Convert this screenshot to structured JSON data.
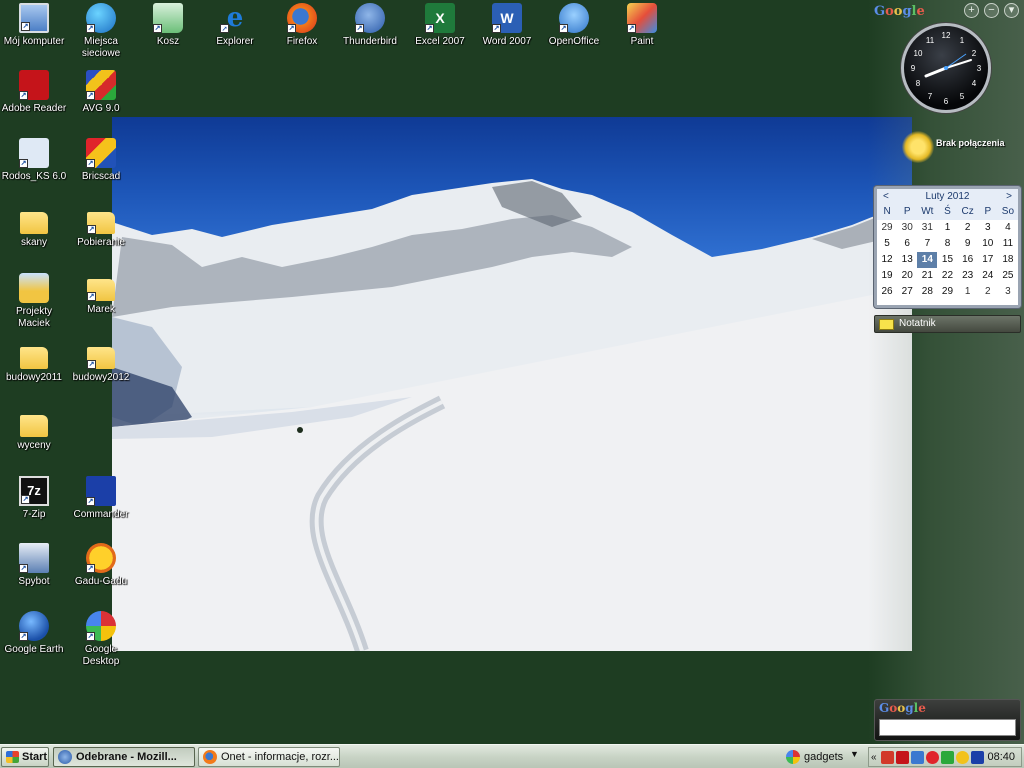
{
  "desktop_icons": [
    {
      "label": "Mój komputer",
      "icon": "computer-icon"
    },
    {
      "label": "Miejsca sieciowe",
      "icon": "network-places-icon"
    },
    {
      "label": "Kosz",
      "icon": "recycle-bin-icon"
    },
    {
      "label": "Explorer",
      "icon": "internet-explorer-icon"
    },
    {
      "label": "Firefox",
      "icon": "firefox-icon"
    },
    {
      "label": "Thunderbird",
      "icon": "thunderbird-icon"
    },
    {
      "label": "Excel 2007",
      "icon": "excel-icon",
      "glyph": "X"
    },
    {
      "label": "Word 2007",
      "icon": "word-icon",
      "glyph": "W"
    },
    {
      "label": "OpenOffice",
      "icon": "openoffice-icon"
    },
    {
      "label": "Paint",
      "icon": "paint-icon"
    },
    {
      "label": "Adobe Reader",
      "icon": "adobe-reader-icon"
    },
    {
      "label": "AVG 9.0",
      "icon": "avg-icon"
    },
    {
      "label": "Rodos_KS 6.0",
      "icon": "rodos-icon"
    },
    {
      "label": "Bricscad",
      "icon": "bricscad-icon"
    },
    {
      "label": "skany",
      "icon": "folder-icon"
    },
    {
      "label": "Pobieranie",
      "icon": "folder-icon"
    },
    {
      "label": "Projekty Maciek",
      "icon": "projects-icon"
    },
    {
      "label": "Marek",
      "icon": "folder-icon"
    },
    {
      "label": "budowy2011",
      "icon": "folder-icon"
    },
    {
      "label": "budowy2012",
      "icon": "folder-icon"
    },
    {
      "label": "wyceny",
      "icon": "folder-icon"
    },
    {
      "label": "7-Zip",
      "icon": "7zip-icon",
      "glyph": "7z"
    },
    {
      "label": "Commander",
      "icon": "commander-icon"
    },
    {
      "label": "Spybot",
      "icon": "spybot-icon"
    },
    {
      "label": "Gadu-Gadu",
      "icon": "gadu-gadu-icon"
    },
    {
      "label": "Google Earth",
      "icon": "google-earth-icon"
    },
    {
      "label": "Google Desktop",
      "icon": "google-desktop-icon"
    }
  ],
  "sidebar": {
    "logo": {
      "g1": "G",
      "o1": "o",
      "o2": "o",
      "g2": "g",
      "l": "l",
      "e": "e"
    },
    "buttons": [
      "+",
      "−",
      "▾"
    ],
    "clock": {
      "time": "08:40"
    },
    "weather": {
      "status": "Brak połączenia"
    },
    "calendar": {
      "month": "Luty 2012",
      "prev": "<",
      "next": ">",
      "weekdays": [
        "N",
        "P",
        "Wt",
        "Ś",
        "Cz",
        "P",
        "So"
      ],
      "weeks": [
        [
          "29",
          "30",
          "31",
          "1",
          "2",
          "3",
          "4"
        ],
        [
          "5",
          "6",
          "7",
          "8",
          "9",
          "10",
          "11"
        ],
        [
          "12",
          "13",
          "14",
          "15",
          "16",
          "17",
          "18"
        ],
        [
          "19",
          "20",
          "21",
          "22",
          "23",
          "24",
          "25"
        ],
        [
          "26",
          "27",
          "28",
          "29",
          "1",
          "2",
          "3"
        ]
      ],
      "today": "14"
    },
    "notes": {
      "label": "Notatnik"
    },
    "search": {
      "logo": "Google",
      "value": ""
    }
  },
  "taskbar": {
    "start_label": "Start",
    "tasks": [
      {
        "label": "Odebrane - Mozill...",
        "icon": "thunderbird-icon",
        "active": true
      },
      {
        "label": "Onet - informacje, rozr...",
        "icon": "firefox-icon",
        "active": false
      }
    ],
    "gadgets_label": "gadgets",
    "tray": {
      "chevron": "«",
      "icons": [
        "antivirus-icon",
        "adobe-tray-icon",
        "network-tray-icon",
        "security-tray-icon",
        "update-tray-icon",
        "shield-tray-icon",
        "display-tray-icon"
      ],
      "clock": "08:40"
    }
  },
  "colors": {
    "desktop_bg": "#1e3d22",
    "taskbar_bg": "#c9d4c6",
    "calendar_today": "#5d7fa8"
  }
}
